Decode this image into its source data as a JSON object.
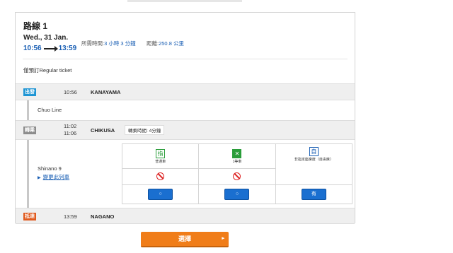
{
  "route": {
    "title": "路線 1",
    "date": "Wed., 31 Jan.",
    "depart_time": "10:56",
    "arrive_time": "13:59",
    "duration_label": "所需時間:",
    "duration_value": "3 小時 3 分鐘",
    "distance_label": "距離:",
    "distance_value": "250.8 公里",
    "ticket_note": "僅預訂Regular ticket"
  },
  "stops": [
    {
      "tag": "出發",
      "tag_color": "#1e95d4",
      "time": "10:56",
      "station": "KANAYAMA"
    },
    {
      "tag": "轉乘",
      "tag_color": "#8c8c8c",
      "time_arrive": "11:02",
      "time_depart": "11:06",
      "station": "CHIKUSA",
      "transfer_time": "轉乘時間: 4分鐘"
    },
    {
      "tag": "抵達",
      "tag_color": "#e05a1e",
      "time": "13:59",
      "station": "NAGANO"
    }
  ],
  "segments": [
    {
      "line": "Chuo Line"
    },
    {
      "line": "Shinano 9",
      "change_link": "變更此列車"
    }
  ],
  "seats": {
    "classes": [
      {
        "icon": "指",
        "label": "普通車",
        "icon_name": "reserved-seat-icon"
      },
      {
        "icon": "✕",
        "label": "1等車",
        "icon_name": "green-car-icon"
      },
      {
        "icon": "自",
        "label": "非指定座席度（自由席）",
        "icon_name": "non-reserved-seat-icon"
      }
    ],
    "availability": [
      "○",
      "○",
      "有"
    ]
  },
  "select_button": "選擇"
}
